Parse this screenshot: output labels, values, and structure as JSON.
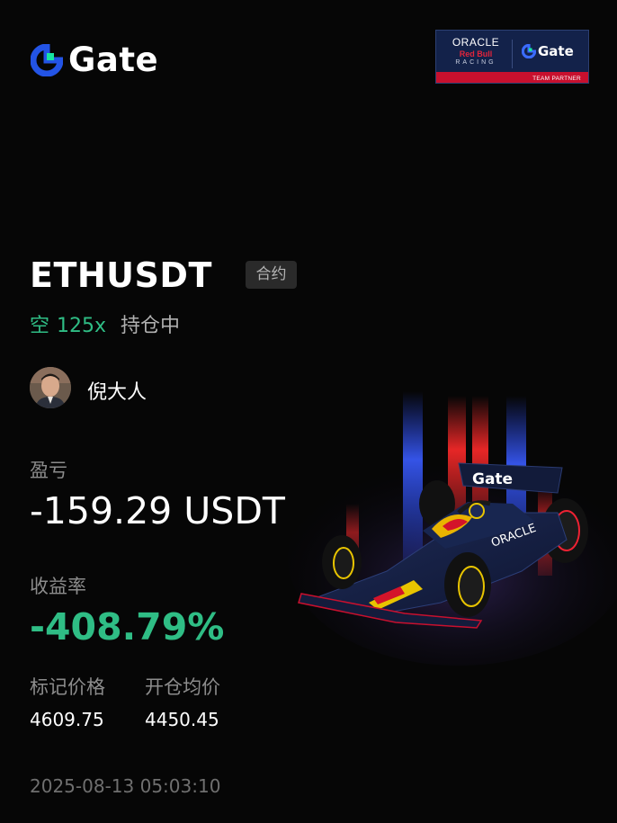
{
  "brand": {
    "name": "Gate",
    "accent": "#2354e6",
    "accent2": "#17e6a1"
  },
  "partner": {
    "oracle": "ORACLE",
    "redbull": "Red Bull",
    "racing": "RACING",
    "gate": "Gate",
    "tagline": "TEAM PARTNER"
  },
  "position": {
    "symbol": "ETHUSDT",
    "type_tag": "合约",
    "side": "空",
    "leverage": "125x",
    "status": "持仓中"
  },
  "user": {
    "name": "倪大人"
  },
  "pnl": {
    "label": "盈亏",
    "value": "-159.29 USDT"
  },
  "roi": {
    "label": "收益率",
    "value": "-408.79%"
  },
  "prices": {
    "mark_label": "标记价格",
    "mark_value": "4609.75",
    "entry_label": "开仓均价",
    "entry_value": "4450.45"
  },
  "timestamp": "2025-08-13 05:03:10",
  "colors": {
    "profit_green": "#2fbd85",
    "muted": "#8c8c8c",
    "background": "#060606"
  }
}
